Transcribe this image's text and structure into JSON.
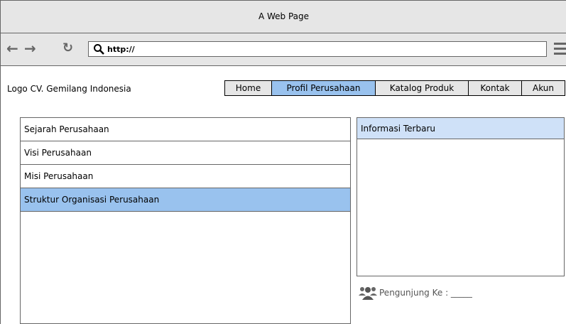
{
  "window": {
    "title": "A Web Page"
  },
  "browser": {
    "url": "http://"
  },
  "site": {
    "logo": "Logo CV. Gemilang Indonesia",
    "tabs": [
      {
        "label": "Home",
        "active": false
      },
      {
        "label": "Profil Perusahaan",
        "active": true
      },
      {
        "label": "Katalog Produk",
        "active": false
      },
      {
        "label": "Kontak",
        "active": false
      },
      {
        "label": "Akun",
        "active": false
      }
    ]
  },
  "left_menu": {
    "items": [
      {
        "label": "Sejarah Perusahaan",
        "active": false
      },
      {
        "label": "Visi Perusahaan",
        "active": false
      },
      {
        "label": "Misi Perusahaan",
        "active": false
      },
      {
        "label": "Struktur Organisasi Perusahaan",
        "active": true
      }
    ]
  },
  "info_panel": {
    "title": "Informasi Terbaru"
  },
  "visitor": {
    "label": "Pengunjung Ke : _____"
  },
  "colors": {
    "accent": "#99c2ee",
    "header_light": "#cfe1f8",
    "chrome": "#e6e6e6"
  }
}
